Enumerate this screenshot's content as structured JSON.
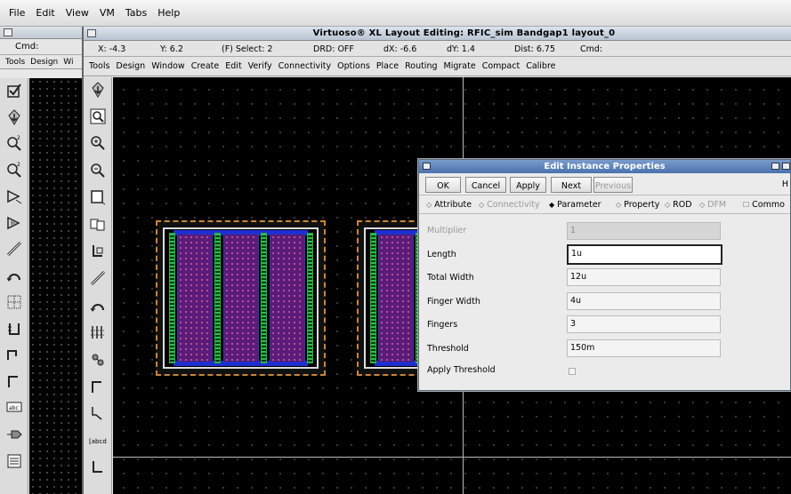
{
  "vm_menu": [
    "File",
    "Edit",
    "View",
    "VM",
    "Tabs",
    "Help"
  ],
  "back_window": {
    "cmd_label": "Cmd:",
    "menu": [
      "Tools",
      "Design",
      "Wi"
    ]
  },
  "front_window": {
    "title": "Virtuoso® XL Layout Editing: RFIC_sim Bandgap1 layout_0",
    "status": {
      "x": "X: -4.3",
      "y": "Y: 6.2",
      "select": "(F) Select: 2",
      "drd": "DRD: OFF",
      "dx": "dX: -6.6",
      "dy": "dY: 1.4",
      "dist": "Dist: 6.75",
      "cmd": "Cmd:"
    },
    "menu": [
      "Tools",
      "Design",
      "Window",
      "Create",
      "Edit",
      "Verify",
      "Connectivity",
      "Options",
      "Place",
      "Routing",
      "Migrate",
      "Compact",
      "Calibre"
    ]
  },
  "toolbar_icons": {
    "back": [
      "checkbox-icon",
      "save-icon",
      "zoom-in-icon",
      "zoom-out-icon",
      "stretch-icon",
      "copy-icon",
      "path-icon",
      "undo-arc-icon",
      "ruler-icon",
      "instance-icon",
      "wire-icon",
      "wire-corner-icon",
      "label-icon",
      "pin-icon",
      "property-icon"
    ],
    "front": [
      "save-icon",
      "magnify-icon",
      "zoom-in-icon",
      "zoom-out-icon",
      "window-icon",
      "window-fit-icon",
      "instance-icon",
      "path-icon",
      "undo-arc-icon",
      "array-icon",
      "move-icon",
      "wire-corner-icon",
      "pointer-icon",
      "label-box-icon",
      "shape-icon"
    ],
    "front_label_icon": "[abcd]",
    "back_label_icon": "abc"
  },
  "dialog": {
    "title": "Edit Instance Properties",
    "buttons": [
      {
        "label": "OK",
        "enabled": true
      },
      {
        "label": "Cancel",
        "enabled": true
      },
      {
        "label": "Apply",
        "enabled": true
      },
      {
        "label": "Next",
        "enabled": true
      },
      {
        "label": "Previous",
        "enabled": false
      }
    ],
    "help_label": "H",
    "tabs": [
      {
        "label": "Attribute",
        "selected": false,
        "enabled": true
      },
      {
        "label": "Connectivity",
        "selected": false,
        "enabled": false
      },
      {
        "label": "Parameter",
        "selected": true,
        "enabled": true
      },
      {
        "label": "Property",
        "selected": false,
        "enabled": true
      },
      {
        "label": "ROD",
        "selected": false,
        "enabled": true
      },
      {
        "label": "DFM",
        "selected": false,
        "enabled": false
      }
    ],
    "common_label": "Commo",
    "fields": [
      {
        "label": "Multiplier",
        "value": "1",
        "enabled": false
      },
      {
        "label": "Length",
        "value": "1u",
        "enabled": true,
        "active": true
      },
      {
        "label": "Total Width",
        "value": "12u",
        "enabled": true
      },
      {
        "label": "Finger Width",
        "value": "4u",
        "enabled": true
      },
      {
        "label": "Fingers",
        "value": "3",
        "enabled": true
      },
      {
        "label": "Threshold",
        "value": "150m",
        "enabled": true
      }
    ],
    "apply_threshold_label": "Apply Threshold",
    "apply_threshold_checked": false
  }
}
